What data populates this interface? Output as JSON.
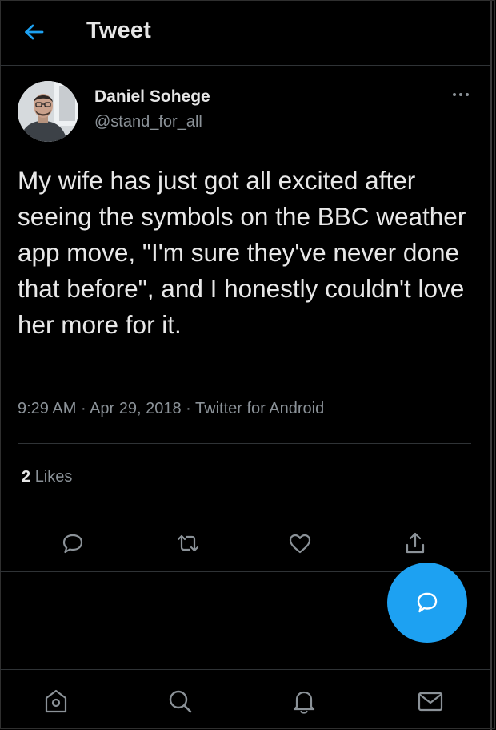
{
  "header": {
    "title": "Tweet",
    "back_icon": "arrow-left-icon"
  },
  "tweet": {
    "author_name": "Daniel Sohege",
    "author_handle": "@stand_for_all",
    "text": "My wife has just got all excited after seeing the symbols on the BBC weather app move, \"I'm sure they've never done that before\", and I honestly couldn't love her more for it.",
    "time": "9:29 AM",
    "date": "Apr 29, 2018",
    "source": "Twitter for Android",
    "meta_separator": " · ",
    "likes_count": "2",
    "likes_label": "Likes"
  },
  "actions": [
    "reply-icon",
    "retweet-icon",
    "like-icon",
    "share-icon"
  ],
  "fab": {
    "icon": "compose-reply-icon"
  },
  "bottom_nav": [
    "home-icon",
    "search-icon",
    "notifications-icon",
    "messages-icon"
  ],
  "colors": {
    "accent": "#1da1f2",
    "background": "#000000",
    "secondary_text": "#8b9298",
    "divider": "#2f3336"
  }
}
